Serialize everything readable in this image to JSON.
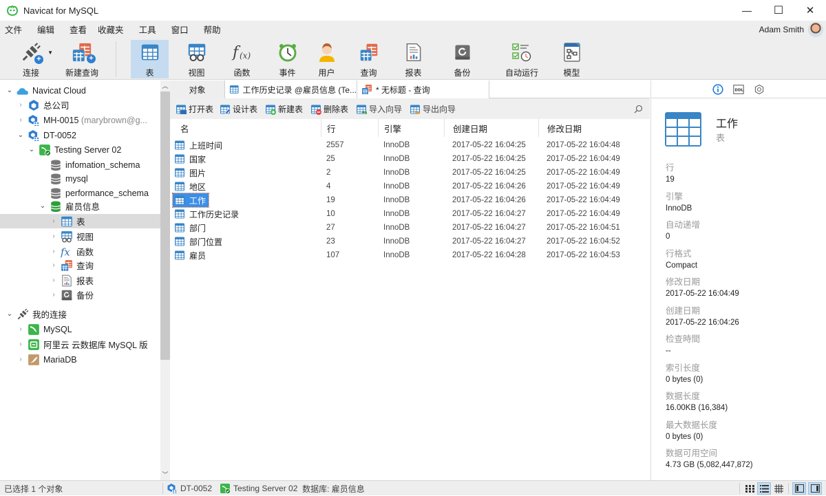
{
  "app": {
    "title": "Navicat for MySQL"
  },
  "window_controls": {
    "minimize": "—",
    "maximize": "☐",
    "close": "✕"
  },
  "menu": [
    "文件",
    "编辑",
    "查看",
    "收藏夹",
    "工具",
    "窗口",
    "帮助"
  ],
  "user": {
    "name": "Adam Smith"
  },
  "toolbar": [
    {
      "label": "连接",
      "icon": "connection-plug-icon"
    },
    {
      "label": "新建查询",
      "icon": "new-query-icon"
    },
    {
      "label": "表",
      "icon": "table-icon",
      "active": true
    },
    {
      "label": "视图",
      "icon": "view-icon"
    },
    {
      "label": "函数",
      "icon": "function-icon"
    },
    {
      "label": "事件",
      "icon": "event-clock-icon"
    },
    {
      "label": "用户",
      "icon": "user-icon"
    },
    {
      "label": "查询",
      "icon": "query-icon"
    },
    {
      "label": "报表",
      "icon": "report-icon"
    },
    {
      "label": "备份",
      "icon": "backup-icon"
    },
    {
      "label": "自动运行",
      "icon": "automation-icon"
    },
    {
      "label": "模型",
      "icon": "model-icon"
    }
  ],
  "tree": [
    {
      "label": "Navicat Cloud",
      "icon": "cloud-icon",
      "expanded": true
    },
    {
      "label": "总公司",
      "icon": "project-icon",
      "expanded": false
    },
    {
      "label": "MH-0015",
      "extra": "(marybrown@g...",
      "icon": "shared-project-icon",
      "expanded": false
    },
    {
      "label": "DT-0052",
      "icon": "shared-project-icon",
      "expanded": true
    },
    {
      "label": "Testing Server 02",
      "icon": "mysql-connected-icon",
      "expanded": true
    },
    {
      "label": "infomation_schema",
      "icon": "database-icon"
    },
    {
      "label": "mysql",
      "icon": "database-icon"
    },
    {
      "label": "performance_schema",
      "icon": "database-icon"
    },
    {
      "label": "雇员信息",
      "icon": "database-open-icon",
      "expanded": true
    },
    {
      "label": "表",
      "icon": "table-icon",
      "selected": true
    },
    {
      "label": "视图",
      "icon": "view-icon"
    },
    {
      "label": "函数",
      "icon": "function-icon"
    },
    {
      "label": "查询",
      "icon": "query-icon"
    },
    {
      "label": "报表",
      "icon": "report-icon"
    },
    {
      "label": "备份",
      "icon": "backup-icon"
    },
    {
      "label": "我的连接",
      "icon": "connection-plug-icon",
      "expanded": true
    },
    {
      "label": "MySQL",
      "icon": "mysql-icon"
    },
    {
      "label": "阿里云 云数据库 MySQL 版",
      "icon": "aliyun-icon"
    },
    {
      "label": "MariaDB",
      "icon": "mariadb-icon"
    }
  ],
  "tabs": [
    {
      "label": "对象"
    },
    {
      "label": "工作历史记录 @雇员信息 (Te..."
    },
    {
      "label": "* 无标题 - 查询"
    }
  ],
  "object_toolbar": [
    "打开表",
    "设计表",
    "新建表",
    "删除表",
    "导入向导",
    "导出向导"
  ],
  "columns": [
    "名",
    "行",
    "引擎",
    "创建日期",
    "修改日期"
  ],
  "rows": [
    {
      "name": "上班时间",
      "rows": "2557",
      "engine": "InnoDB",
      "created": "2017-05-22 16:04:25",
      "modified": "2017-05-22 16:04:48"
    },
    {
      "name": "国家",
      "rows": "25",
      "engine": "InnoDB",
      "created": "2017-05-22 16:04:25",
      "modified": "2017-05-22 16:04:49"
    },
    {
      "name": "图片",
      "rows": "2",
      "engine": "InnoDB",
      "created": "2017-05-22 16:04:25",
      "modified": "2017-05-22 16:04:49"
    },
    {
      "name": "地区",
      "rows": "4",
      "engine": "InnoDB",
      "created": "2017-05-22 16:04:26",
      "modified": "2017-05-22 16:04:49"
    },
    {
      "name": "工作",
      "rows": "19",
      "engine": "InnoDB",
      "created": "2017-05-22 16:04:26",
      "modified": "2017-05-22 16:04:49",
      "selected": true
    },
    {
      "name": "工作历史记录",
      "rows": "10",
      "engine": "InnoDB",
      "created": "2017-05-22 16:04:27",
      "modified": "2017-05-22 16:04:49"
    },
    {
      "name": "部门",
      "rows": "27",
      "engine": "InnoDB",
      "created": "2017-05-22 16:04:27",
      "modified": "2017-05-22 16:04:51"
    },
    {
      "name": "部门位置",
      "rows": "23",
      "engine": "InnoDB",
      "created": "2017-05-22 16:04:27",
      "modified": "2017-05-22 16:04:52"
    },
    {
      "name": "雇员",
      "rows": "107",
      "engine": "InnoDB",
      "created": "2017-05-22 16:04:28",
      "modified": "2017-05-22 16:04:53"
    }
  ],
  "info_panel": {
    "tabs": [
      "info-icon",
      "ddl-icon",
      "settings-hexagon-icon"
    ],
    "object_name": "工作",
    "object_type": "表",
    "properties": [
      {
        "key": "行",
        "value": "19"
      },
      {
        "key": "引擎",
        "value": "InnoDB"
      },
      {
        "key": "自动递增",
        "value": "0"
      },
      {
        "key": "行格式",
        "value": "Compact"
      },
      {
        "key": "修改日期",
        "value": "2017-05-22 16:04:49"
      },
      {
        "key": "创建日期",
        "value": "2017-05-22 16:04:26"
      },
      {
        "key": "检查時間",
        "value": "--"
      },
      {
        "key": "索引长度",
        "value": "0 bytes (0)"
      },
      {
        "key": "数据长度",
        "value": "16.00KB (16,384)"
      },
      {
        "key": "最大数据长度",
        "value": "0 bytes (0)"
      },
      {
        "key": "数据可用空间",
        "value": "4.73 GB (5,082,447,872)"
      }
    ]
  },
  "status": {
    "selection": "已选择 1 个对象",
    "project": "DT-0052",
    "server": "Testing Server 02",
    "database": "数据库: 雇员信息"
  },
  "colors": {
    "accent": "#3d8ee6",
    "toolbar_active": "#c5dcf0",
    "table_icon": "#3a85c6"
  }
}
